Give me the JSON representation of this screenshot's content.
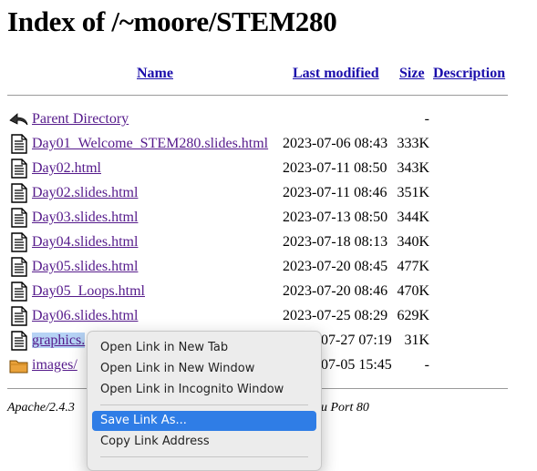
{
  "page": {
    "title": "Index of /~moore/STEM280",
    "columns": {
      "name": "Name",
      "last_modified": "Last modified",
      "size": "Size",
      "description": "Description"
    },
    "rows": [
      {
        "icon": "back-icon",
        "name": "Parent Directory",
        "modified": "",
        "size": "-"
      },
      {
        "icon": "text-file-icon",
        "name": "Day01_Welcome_STEM280.slides.html",
        "modified": "2023-07-06 08:43",
        "size": "333K"
      },
      {
        "icon": "text-file-icon",
        "name": "Day02.html",
        "modified": "2023-07-11 08:50",
        "size": "343K"
      },
      {
        "icon": "text-file-icon",
        "name": "Day02.slides.html",
        "modified": "2023-07-11 08:46",
        "size": "351K"
      },
      {
        "icon": "text-file-icon",
        "name": "Day03.slides.html",
        "modified": "2023-07-13 08:50",
        "size": "344K"
      },
      {
        "icon": "text-file-icon",
        "name": "Day04.slides.html",
        "modified": "2023-07-18 08:13",
        "size": "340K"
      },
      {
        "icon": "text-file-icon",
        "name": "Day05.slides.html",
        "modified": "2023-07-20 08:45",
        "size": "477K"
      },
      {
        "icon": "text-file-icon",
        "name": "Day05_Loops.html",
        "modified": "2023-07-20 08:46",
        "size": "470K"
      },
      {
        "icon": "text-file-icon",
        "name": "Day06.slides.html",
        "modified": "2023-07-25 08:29",
        "size": "629K"
      },
      {
        "icon": "text-file-icon",
        "name": "graphics.",
        "modified": "07-27 07:19",
        "size": "31K"
      },
      {
        "icon": "folder-icon",
        "name": "images/",
        "modified": "07-05 15:45",
        "size": "-"
      }
    ],
    "address_left": "Apache/2.4.3",
    "address_right": "du Port 80"
  },
  "context_menu": {
    "items": [
      "Open Link in New Tab",
      "Open Link in New Window",
      "Open Link in Incognito Window",
      "Save Link As...",
      "Copy Link Address"
    ],
    "highlighted": "Save Link As..."
  },
  "colors": {
    "link": "#551a8b",
    "header_link": "#1a0dab",
    "menu_highlight": "#2f7de6"
  }
}
